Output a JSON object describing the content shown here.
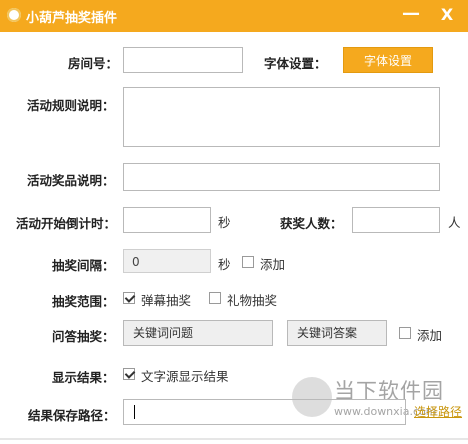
{
  "window": {
    "title": "小葫芦抽奖插件",
    "minimize_glyph": "—",
    "close_glyph": "X",
    "icon": "gourd-logo-icon"
  },
  "room": {
    "label": "房间号：",
    "value": ""
  },
  "font_settings": {
    "label": "字体设置：",
    "button": "字体设置"
  },
  "rules": {
    "label": "活动规则说明：",
    "value": ""
  },
  "prizes": {
    "label": "活动奖品说明：",
    "value": ""
  },
  "countdown": {
    "label": "活动开始倒计时：",
    "value": "",
    "unit": "秒"
  },
  "winners": {
    "label": "获奖人数：",
    "value": "",
    "unit": "人"
  },
  "interval": {
    "label": "抽奖间隔：",
    "value": "0",
    "unit": "秒",
    "add_label": "添加",
    "add_checked": false
  },
  "scope": {
    "label": "抽奖范围：",
    "options": [
      {
        "label": "弹幕抽奖",
        "checked": true
      },
      {
        "label": "礼物抽奖",
        "checked": false
      }
    ]
  },
  "qa": {
    "label": "问答抽奖：",
    "keyword_question": "关键词问题",
    "keyword_answer": "关键词答案",
    "add_label": "添加",
    "add_checked": false
  },
  "display": {
    "label": "显示结果：",
    "option": "文字源显示结果",
    "checked": true
  },
  "save_path": {
    "label": "结果保存路径：",
    "value": "",
    "link": "选择路径"
  },
  "watermark": {
    "main": "当下软件园",
    "sub": "www.downxia.com"
  }
}
